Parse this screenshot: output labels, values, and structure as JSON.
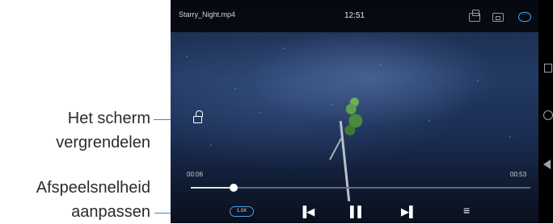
{
  "status_bar": {
    "filename": "Starry_Night.mp4",
    "clock": "12:51",
    "icons": [
      "screenshot-icon",
      "cast-icon",
      "more-icon"
    ]
  },
  "player": {
    "lock_icon": "unlock-icon",
    "time_elapsed": "00:06",
    "time_total": "00:53",
    "progress": 0.125,
    "speed_label": "1.0X",
    "controls": {
      "prev": "▐◀",
      "pause": "▌▌",
      "next": "▶▌",
      "list": "≡"
    }
  },
  "system_nav": [
    "recent-apps-icon",
    "home-icon",
    "back-icon"
  ],
  "callouts": {
    "lock_line1": "Het scherm",
    "lock_line2": "vergrendelen",
    "speed_line1": "Afspeelsnelheid",
    "speed_line2": "aanpassen"
  },
  "colors": {
    "accent": "#2f8fd6",
    "highlight": "#4a9de0"
  }
}
